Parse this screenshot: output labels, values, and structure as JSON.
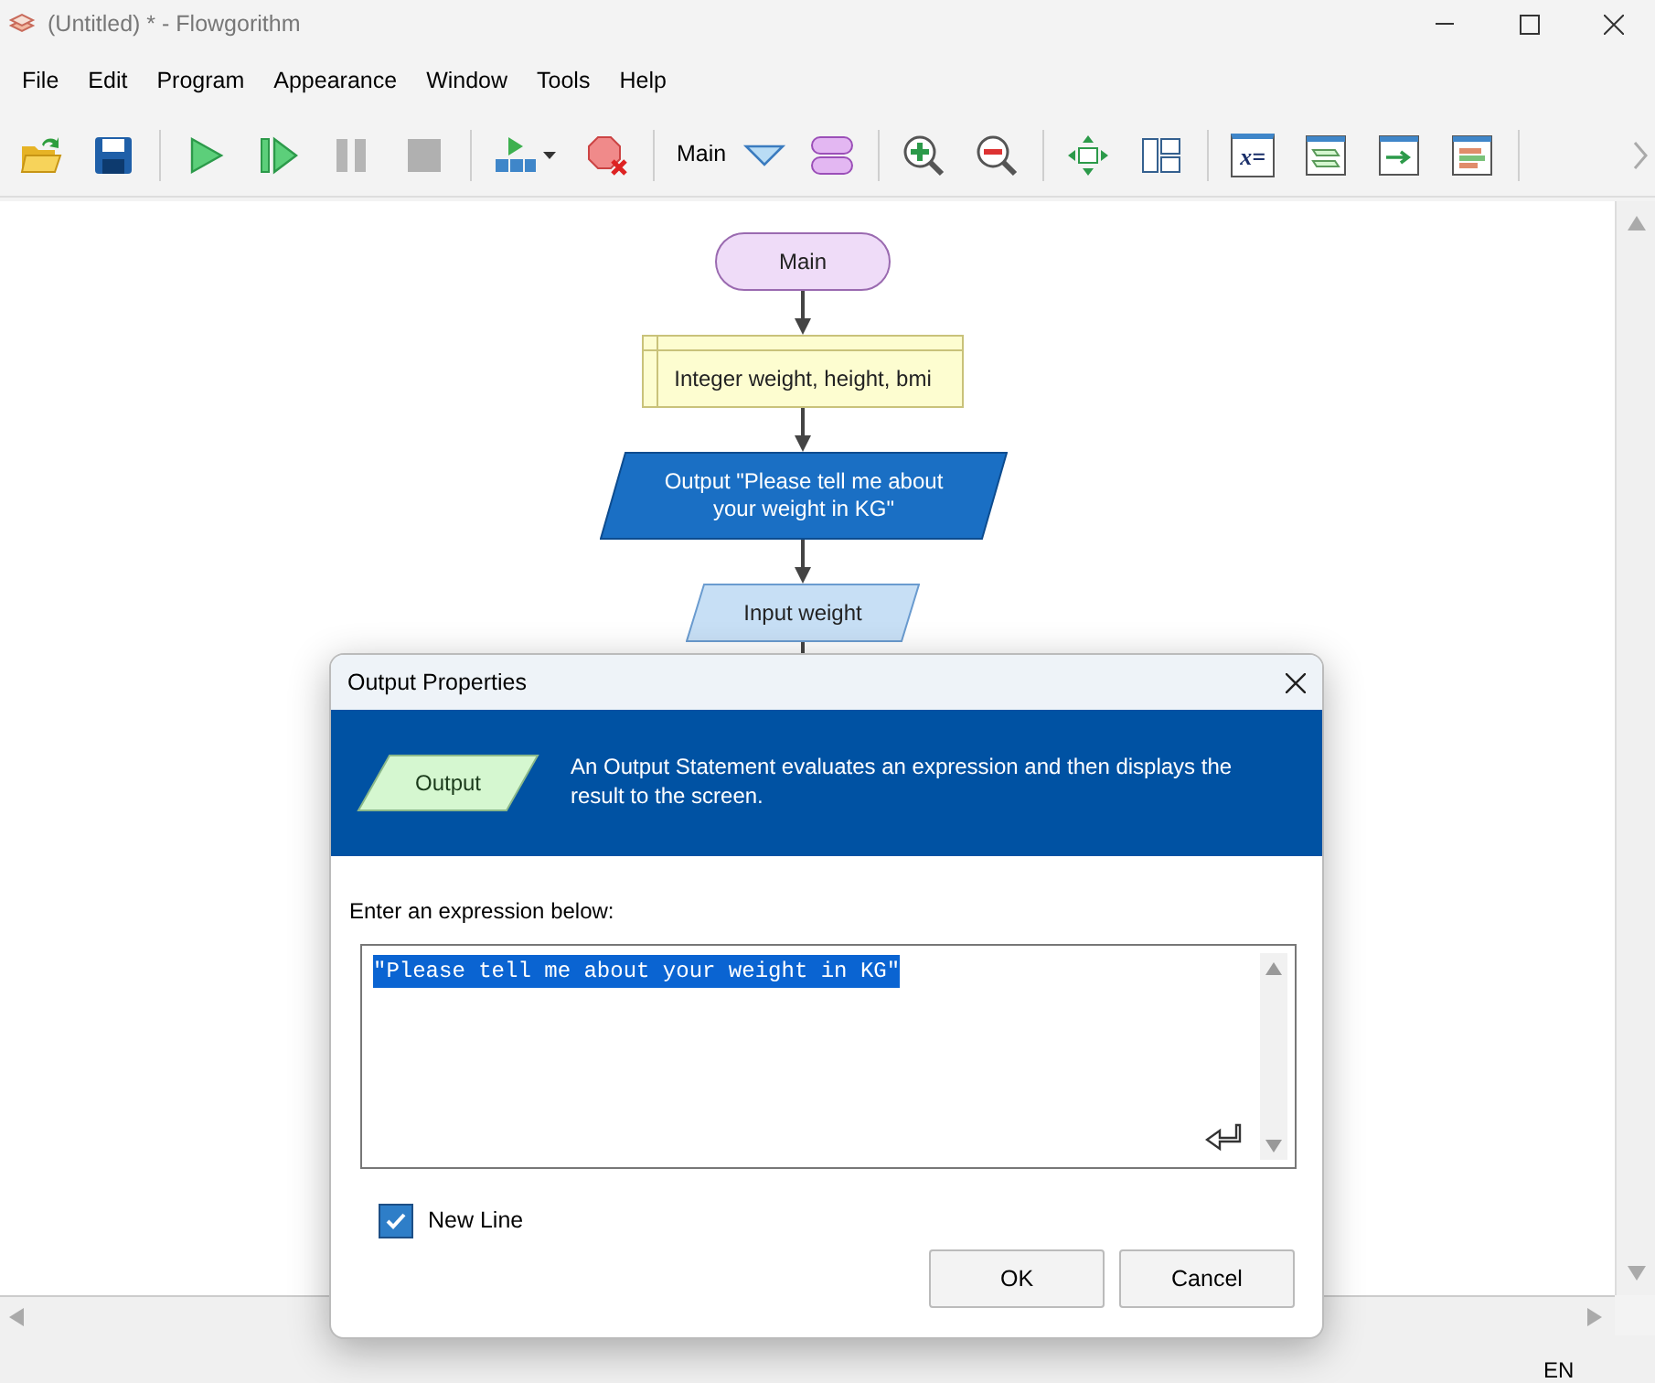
{
  "window": {
    "title": "(Untitled) * - Flowgorithm"
  },
  "menu": [
    "File",
    "Edit",
    "Program",
    "Appearance",
    "Window",
    "Tools",
    "Help"
  ],
  "toolbar": {
    "function_name": "Main",
    "assign_label": "x="
  },
  "flowchart": {
    "nodes": [
      {
        "kind": "terminal",
        "text": "Main",
        "selected": false
      },
      {
        "kind": "declare",
        "text": "Integer weight, height, bmi",
        "selected": false
      },
      {
        "kind": "output",
        "text": "Output \"Please tell me about\nyour weight in KG\"",
        "selected": true
      },
      {
        "kind": "input",
        "text": "Input weight",
        "selected": false
      }
    ]
  },
  "dialog": {
    "title": "Output Properties",
    "badge": "Output",
    "description": "An Output Statement evaluates an expression and then displays the result to the screen.",
    "prompt": "Enter an expression below:",
    "expression": "\"Please tell me about your weight in KG\"",
    "expression_selected": true,
    "new_line": {
      "label": "New Line",
      "checked": true
    },
    "buttons": [
      "OK",
      "Cancel"
    ]
  },
  "status_bar": {
    "language": "EN"
  }
}
